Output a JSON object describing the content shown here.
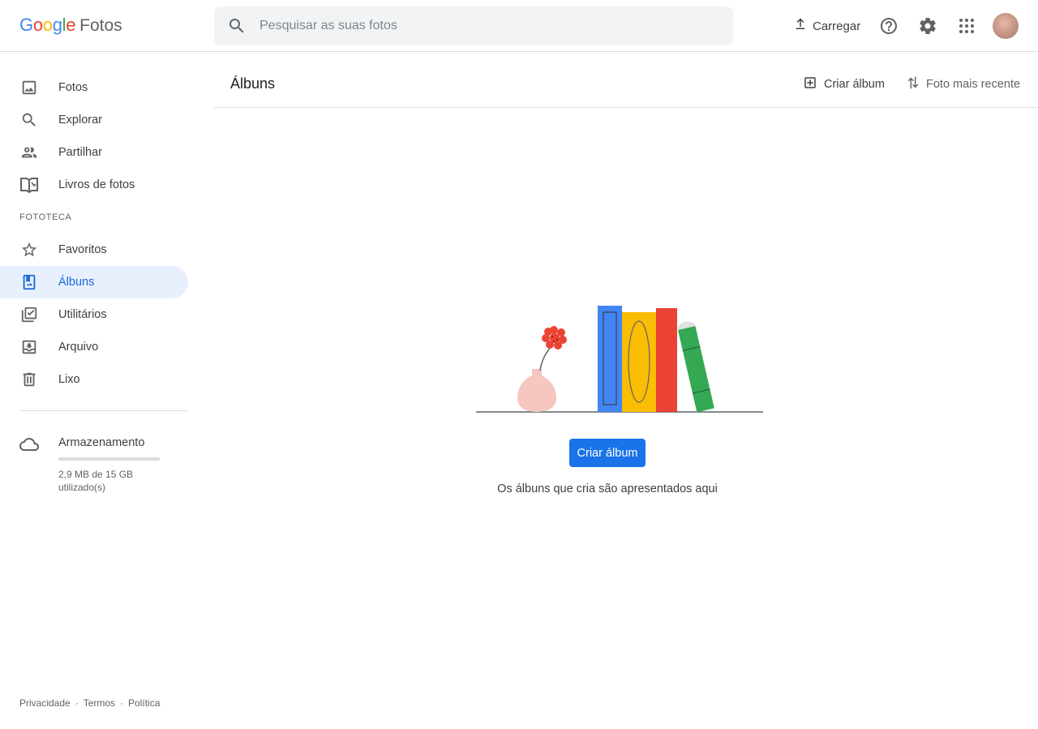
{
  "brand": {
    "google_letters": [
      {
        "ch": "G",
        "color": "#4285F4"
      },
      {
        "ch": "o",
        "color": "#EA4335"
      },
      {
        "ch": "o",
        "color": "#FBBC05"
      },
      {
        "ch": "g",
        "color": "#4285F4"
      },
      {
        "ch": "l",
        "color": "#34A853"
      },
      {
        "ch": "e",
        "color": "#EA4335"
      }
    ],
    "google_text": "Google",
    "product": "Fotos"
  },
  "search": {
    "placeholder": "Pesquisar as suas fotos",
    "icon": "search-icon"
  },
  "topbar": {
    "upload_label": "Carregar",
    "upload_icon": "upload-icon",
    "help_icon": "help-icon",
    "settings_icon": "gear-icon",
    "apps_icon": "apps-grid-icon"
  },
  "sidebar": {
    "items": [
      {
        "label": "Fotos",
        "icon": "photo-icon"
      },
      {
        "label": "Explorar",
        "icon": "search-icon"
      },
      {
        "label": "Partilhar",
        "icon": "people-icon"
      },
      {
        "label": "Livros de fotos",
        "icon": "book-icon"
      }
    ],
    "library_label": "FOTOTECA",
    "library_items": [
      {
        "label": "Favoritos",
        "icon": "star-icon"
      },
      {
        "label": "Álbuns",
        "icon": "album-icon",
        "active": true
      },
      {
        "label": "Utilitários",
        "icon": "utilities-icon"
      },
      {
        "label": "Arquivo",
        "icon": "archive-icon"
      },
      {
        "label": "Lixo",
        "icon": "trash-icon"
      }
    ],
    "storage": {
      "title": "Armazenamento",
      "usage": "2,9 MB de 15 GB utilizado(s)",
      "fraction_used": 0.0002,
      "icon": "cloud-icon"
    },
    "footer": {
      "privacy": "Privacidade",
      "terms": "Termos",
      "policy": "Política",
      "separator": "·"
    }
  },
  "main": {
    "title": "Álbuns",
    "create_album_label": "Criar álbum",
    "sort_label": "Foto mais recente",
    "empty_state": {
      "button_label": "Criar álbum",
      "message": "Os álbuns que cria são apresentados aqui"
    }
  },
  "colors": {
    "accent": "#1a73e8",
    "active_bg": "#e8f0fe",
    "active_text": "#1967d2"
  }
}
